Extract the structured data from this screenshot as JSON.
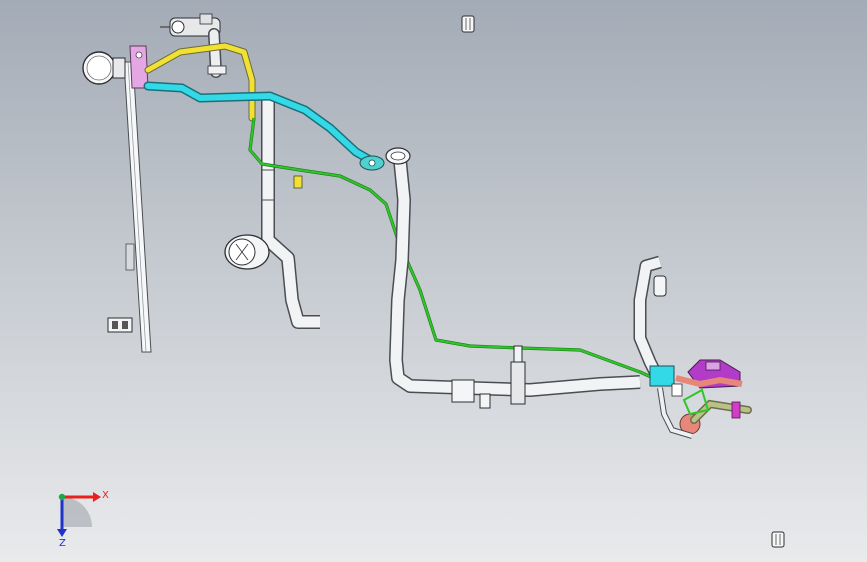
{
  "viewport": {
    "background_top": "#a3abb6",
    "background_bottom": "#e9eaec"
  },
  "triad": {
    "x_label": "X",
    "z_label": "Z",
    "x_color": "#e8211e",
    "y_color": "#1fa64a",
    "z_color": "#1f33c8"
  },
  "harness": {
    "colors": {
      "tube": "#f1f3f5",
      "tube_edge": "#4a4d52",
      "cyan_hose": "#33d9e6",
      "yellow_hose": "#f2e133",
      "green_wire": "#2fc62a",
      "magenta_part": "#b23cc8",
      "salmon_part": "#e6877a",
      "olive_part": "#b9c08a"
    }
  }
}
